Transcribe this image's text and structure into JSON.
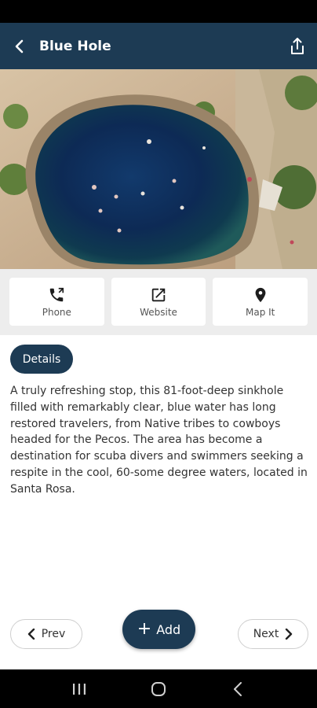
{
  "app_bar": {
    "title": "Blue Hole",
    "back_icon": "arrow-left-icon",
    "share_icon": "share-icon",
    "background": "#1d3b54"
  },
  "hero": {
    "image": "aerial-sinkhole-photo"
  },
  "actions": [
    {
      "label": "Phone",
      "icon": "phone-icon"
    },
    {
      "label": "Website",
      "icon": "external-link-icon"
    },
    {
      "label": "Map It",
      "icon": "map-pin-icon"
    }
  ],
  "details": {
    "label": "Details"
  },
  "description": "A truly refreshing stop, this 81-foot-deep sinkhole filled with remarkably clear, blue water has long restored travelers, from Native tribes to cowboys headed for the Pecos. The area has become a destination for scuba divers and swimmers seeking a respite in the cool, 60-some degree waters, located in Santa Rosa.",
  "footer": {
    "prev_label": "Prev",
    "add_label": "Add",
    "next_label": "Next"
  },
  "colors": {
    "primary": "#1d3b54",
    "action_bg": "#ededed"
  }
}
